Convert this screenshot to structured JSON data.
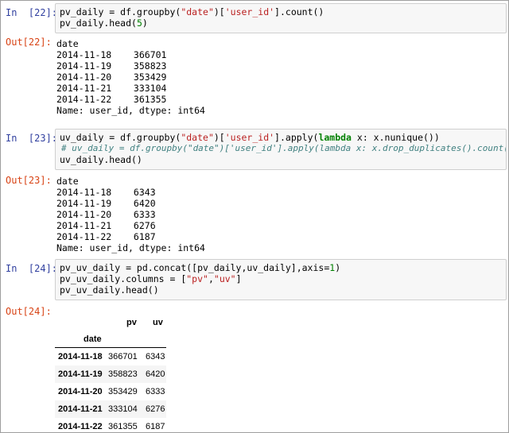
{
  "cells": [
    {
      "in_prompt": "In  [22]:",
      "code": [
        "pv_daily = df.groupby(",
        "\"date\"",
        ")[",
        "'user_id'",
        "].count()",
        "pv_daily.head(",
        "5",
        ")"
      ],
      "out_prompt": "Out[22]:",
      "output": [
        "date",
        "2014-11-18    366701",
        "2014-11-19    358823",
        "2014-11-20    353429",
        "2014-11-21    333104",
        "2014-11-22    361355",
        "Name: user_id, dtype: int64"
      ]
    },
    {
      "in_prompt": "In  [23]:",
      "code": [
        "uv_daily = df.groupby(",
        "\"date\"",
        ")[",
        "'user_id'",
        "].apply(",
        "lambda",
        " x: x.nunique())",
        "# uv_daily = df.groupby(\"date\")['user_id'].apply(lambda x: x.drop_duplicates().count())",
        "uv_daily.head()"
      ],
      "out_prompt": "Out[23]:",
      "output": [
        "date",
        "2014-11-18    6343",
        "2014-11-19    6420",
        "2014-11-20    6333",
        "2014-11-21    6276",
        "2014-11-22    6187",
        "Name: user_id, dtype: int64"
      ]
    },
    {
      "in_prompt": "In  [24]:",
      "code": [
        "pv_uv_daily = pd.concat([pv_daily,uv_daily],axis=",
        "1",
        ")",
        "pv_uv_daily.columns = [",
        "\"pv\"",
        ",",
        "\"uv\"",
        "]",
        "pv_uv_daily.head()"
      ],
      "out_prompt": "Out[24]:"
    }
  ],
  "dataframe": {
    "columns": [
      "pv",
      "uv"
    ],
    "index_name": "date",
    "rows": [
      {
        "date": "2014-11-18",
        "pv": "366701",
        "uv": "6343"
      },
      {
        "date": "2014-11-19",
        "pv": "358823",
        "uv": "6420"
      },
      {
        "date": "2014-11-20",
        "pv": "353429",
        "uv": "6333"
      },
      {
        "date": "2014-11-21",
        "pv": "333104",
        "uv": "6276"
      },
      {
        "date": "2014-11-22",
        "pv": "361355",
        "uv": "6187"
      }
    ]
  }
}
